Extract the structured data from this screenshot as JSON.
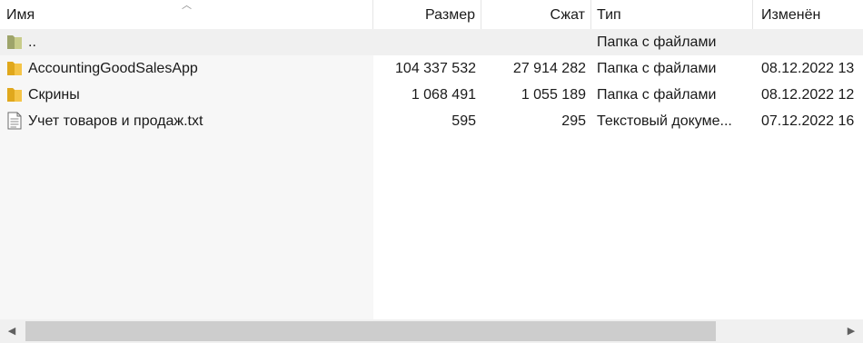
{
  "columns": {
    "name": "Имя",
    "size": "Размер",
    "packed": "Сжат",
    "type": "Тип",
    "modified": "Изменён"
  },
  "rows": [
    {
      "icon": "folder-up-icon",
      "name": "..",
      "size": "",
      "packed": "",
      "type": "Папка с файлами",
      "modified": ""
    },
    {
      "icon": "folder-icon",
      "name": "AccountingGoodSalesApp",
      "size": "104 337 532",
      "packed": "27 914 282",
      "type": "Папка с файлами",
      "modified": "08.12.2022 13"
    },
    {
      "icon": "folder-icon",
      "name": "Скрины",
      "size": "1 068 491",
      "packed": "1 055 189",
      "type": "Папка с файлами",
      "modified": "08.12.2022 12"
    },
    {
      "icon": "text-file-icon",
      "name": "Учет товаров и продаж.txt",
      "size": "595",
      "packed": "295",
      "type": "Текстовый докуме...",
      "modified": "07.12.2022 16"
    }
  ],
  "scroll": {
    "horizontal_position": 0.0,
    "visible_fraction": 0.85
  },
  "colors": {
    "folder": "#f5c447",
    "folder_up": "#c8cc8a",
    "parent_row_bg": "#f0f0f0",
    "name_column_bg": "#f7f7f7"
  }
}
